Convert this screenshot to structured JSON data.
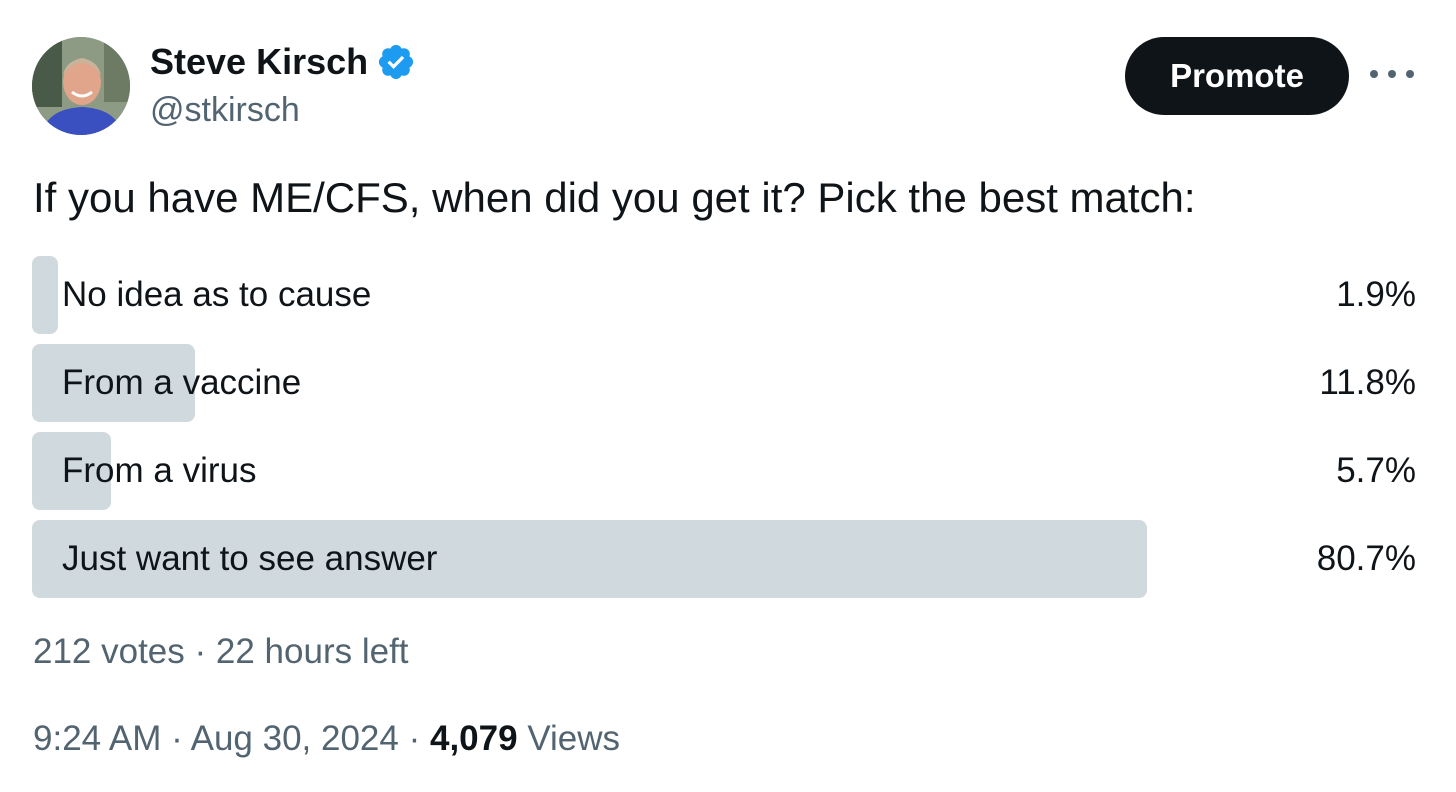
{
  "author": {
    "display_name": "Steve Kirsch",
    "handle": "@stkirsch",
    "verified": true,
    "verified_icon": "verified-badge-icon",
    "verified_color": "#1d9bf0"
  },
  "actions": {
    "promote_label": "Promote",
    "more_icon": "more-horizontal-icon"
  },
  "tweet": {
    "text": "If you have ME/CFS, when did you get it? Pick the best match:"
  },
  "poll": {
    "options": [
      {
        "label": "No idea as to cause",
        "percent_text": "1.9%",
        "percent": 1.9
      },
      {
        "label": "From a vaccine",
        "percent_text": "11.8%",
        "percent": 11.8
      },
      {
        "label": "From a virus",
        "percent_text": "5.7%",
        "percent": 5.7
      },
      {
        "label": "Just want to see answer",
        "percent_text": "80.7%",
        "percent": 80.7
      }
    ],
    "votes": "212 votes",
    "separator": "·",
    "time_left": "22 hours left",
    "bar_color": "#cfd9de"
  },
  "footer": {
    "time": "9:24 AM",
    "separator": "·",
    "date": "Aug 30, 2024",
    "views_count": "4,079",
    "views_label": "Views"
  }
}
